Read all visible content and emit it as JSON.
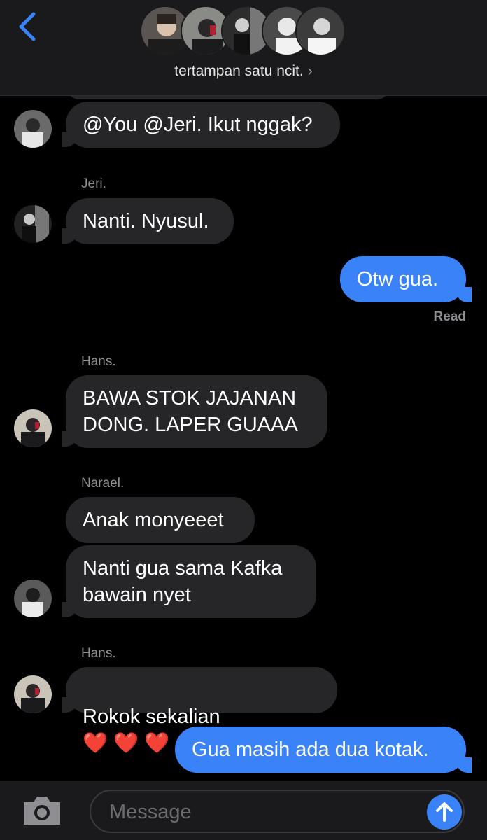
{
  "header": {
    "back_icon": "chevron-left-icon",
    "group_name": "tertampan satu ncit.",
    "title_chevron": "›",
    "accent": "#3a82f7"
  },
  "messages": [
    {
      "side": "in",
      "text": "@You @Jeri. Ikut nggak?"
    },
    {
      "side": "in",
      "sender": "Jeri.",
      "text": "Nanti. Nyusul."
    },
    {
      "side": "out",
      "text": "Otw gua.",
      "status": "Read"
    },
    {
      "side": "in",
      "sender": "Hans.",
      "text": "BAWA STOK JAJANAN\nDONG. LAPER GUAAA"
    },
    {
      "side": "in",
      "sender": "Narael.",
      "text": "Anak monyeeet"
    },
    {
      "side": "in",
      "text": "Nanti gua sama Kafka\nbawain nyet"
    },
    {
      "side": "in",
      "sender": "Hans.",
      "text": "Rokok sekalian",
      "emoji": "❤️ ❤️ ❤️"
    },
    {
      "side": "out",
      "text": "Gua masih ada dua kotak."
    }
  ],
  "composer": {
    "placeholder": "Message",
    "camera_icon": "camera-icon",
    "send_icon": "arrow-up-icon"
  },
  "colors": {
    "bubble_in": "#262628",
    "bubble_out": "#3a82f7",
    "background": "#000000"
  }
}
